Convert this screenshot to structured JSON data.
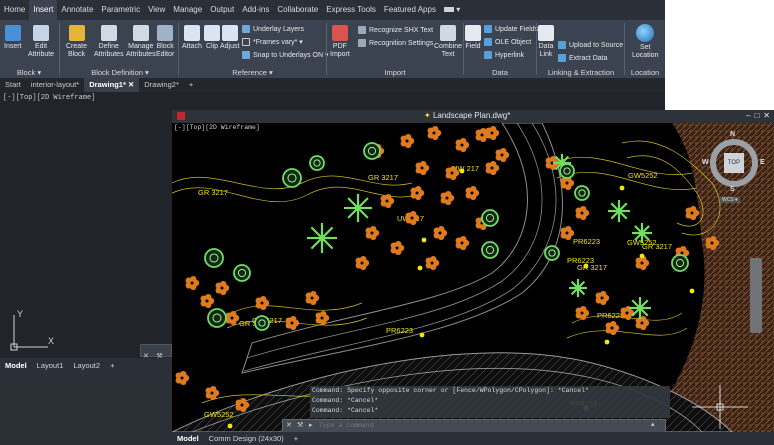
{
  "menu": {
    "items": [
      "Home",
      "Insert",
      "Annotate",
      "Parametric",
      "View",
      "Manage",
      "Output",
      "Add-ins",
      "Collaborate",
      "Express Tools",
      "Featured Apps"
    ],
    "active": "Insert"
  },
  "ribbon": {
    "block": {
      "title": "Block ▾",
      "insert": "Insert",
      "edit_attribute": "Edit\nAttribute"
    },
    "block_def": {
      "title": "Block Definition ▾",
      "create_block": "Create\nBlock",
      "define_attributes": "Define\nAttributes",
      "manage_attributes": "Manage\nAttributes",
      "block_editor": "Block\nEditor"
    },
    "reference": {
      "title": "Reference ▾",
      "attach": "Attach",
      "clip": "Clip",
      "adjust": "Adjust",
      "underlay_layers": "Underlay Layers",
      "frames_vary": "*Frames vary* ▾",
      "snap_underlays": "Snap to Underlays ON ▾"
    },
    "import": {
      "title": "Import",
      "pdf_import": "PDF\nImport",
      "recognize_shx": "Recognize SHX Text",
      "recognition_settings": "Recognition Settings",
      "combine_text": "Combine\nText"
    },
    "data": {
      "title": "Data",
      "field": "Field",
      "update_fields": "Update Fields",
      "ole_object": "OLE Object",
      "hyperlink": "Hyperlink"
    },
    "linking": {
      "title": "Linking & Extraction",
      "data_link": "Data\nLink",
      "upload_source": "Upload to Source",
      "extract_data": "Extract  Data"
    },
    "location": {
      "title": "Location",
      "set_location": "Set\nLocation"
    }
  },
  "file_tabs": [
    "Start",
    "interior-layout*",
    "Drawing1*",
    "Drawing2*"
  ],
  "active_file_tab": "Drawing1*",
  "viewport_label": "[-][Top][2D Wireframe]",
  "layout_tabs_1": [
    "Model",
    "Layout1",
    "Layout2"
  ],
  "window2": {
    "title": "Landscape Plan.dwg*",
    "viewport_label": "[-][Top][2D Wireframe]",
    "labels": [
      "GR 3217",
      "GR 3217",
      "UW 217",
      "UW 217",
      "GR 3217",
      "GR 3217",
      "GR 3217",
      "PR6223",
      "GW5252",
      "PR6223",
      "PR6223",
      "GW5252",
      "GR 3217",
      "PR6223",
      "GW5252",
      "PR6223"
    ],
    "compass": {
      "n": "N",
      "s": "S",
      "e": "E",
      "w": "W",
      "top": "TOP",
      "wcs": "WCS ▾"
    },
    "command_lines": [
      "Command: Specify opposite corner or [Fence/WPolygon/CPolygon]: *Cancel*",
      "Command: *Cancel*",
      "Command: *Cancel*"
    ],
    "command_placeholder": "Type a command",
    "layout_tabs": [
      "Model",
      "Comm Design (24x30)"
    ]
  },
  "colors": {
    "accent": "#0696d7",
    "ribbon": "#3b4350",
    "canvas": "#21252b",
    "plant_orange": "#e07a1f",
    "plant_green": "#4ccd3f",
    "text_yellow": "#f2e511"
  }
}
